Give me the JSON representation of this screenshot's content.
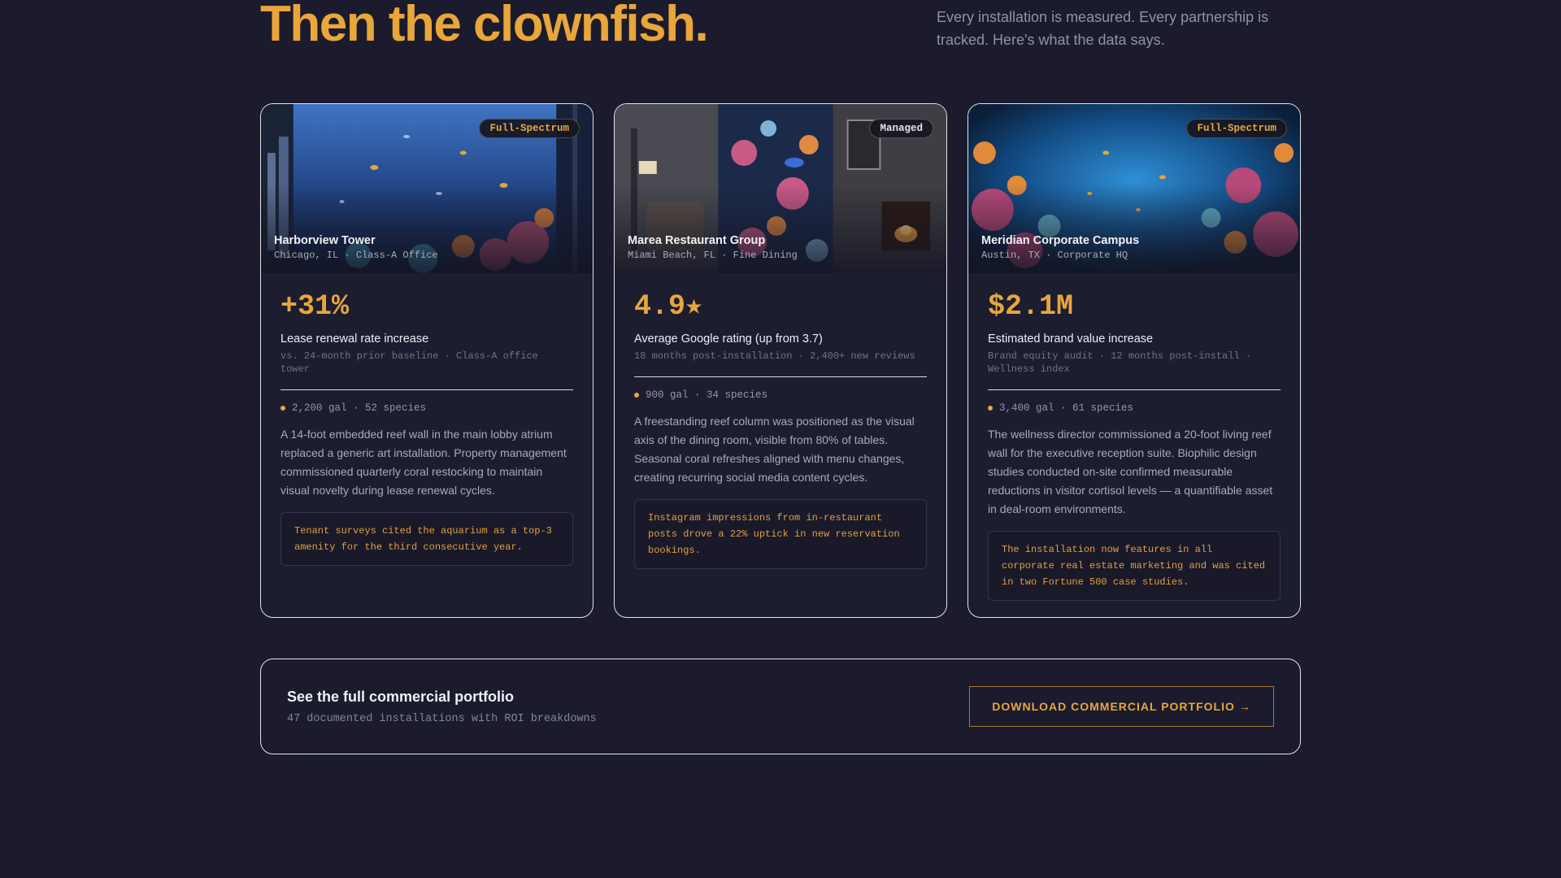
{
  "header": {
    "headline": "Then the clownfish.",
    "intro": "Every installation is measured. Every partnership is tracked. Here's what the data says."
  },
  "cards": [
    {
      "badge": "Full-Spectrum",
      "name": "Harborview Tower",
      "meta": "Chicago, IL · Class-A Office",
      "stat": "+31%",
      "stat_label": "Lease renewal rate increase",
      "stat_sub": "vs. 24-month prior baseline · Class-A office tower",
      "specs": "2,200 gal · 52 species",
      "description": "A 14-foot embedded reef wall in the main lobby atrium replaced a generic art installation. Property management commissioned quarterly coral restocking to maintain visual novelty during lease renewal cycles.",
      "quote": "Tenant surveys cited the aquarium as a top-3 amenity for the third consecutive year."
    },
    {
      "badge": "Managed",
      "name": "Marea Restaurant Group",
      "meta": "Miami Beach, FL · Fine Dining",
      "stat": "4.9★",
      "stat_label": "Average Google rating (up from 3.7)",
      "stat_sub": "18 months post-installation · 2,400+ new reviews",
      "specs": "900 gal · 34 species",
      "description": "A freestanding reef column was positioned as the visual axis of the dining room, visible from 80% of tables. Seasonal coral refreshes aligned with menu changes, creating recurring social media content cycles.",
      "quote": "Instagram impressions from in-restaurant posts drove a 22% uptick in new reservation bookings."
    },
    {
      "badge": "Full-Spectrum",
      "name": "Meridian Corporate Campus",
      "meta": "Austin, TX · Corporate HQ",
      "stat": "$2.1M",
      "stat_label": "Estimated brand value increase",
      "stat_sub": "Brand equity audit · 12 months post-install · Wellness index",
      "specs": "3,400 gal · 61 species",
      "description": "The wellness director commissioned a 20-foot living reef wall for the executive reception suite. Biophilic design studies conducted on-site confirmed measurable reductions in visitor cortisol levels — a quantifiable asset in deal-room environments.",
      "quote": "The installation now features in all corporate real estate marketing and was cited in two Fortune 500 case studies."
    }
  ],
  "cta": {
    "title": "See the full commercial portfolio",
    "subtitle": "47 documented installations with ROI breakdowns",
    "button": "DOWNLOAD COMMERCIAL PORTFOLIO →"
  },
  "colors": {
    "accent": "#e8a63b",
    "background": "#1b1b2d",
    "card": "#1d1d30"
  }
}
